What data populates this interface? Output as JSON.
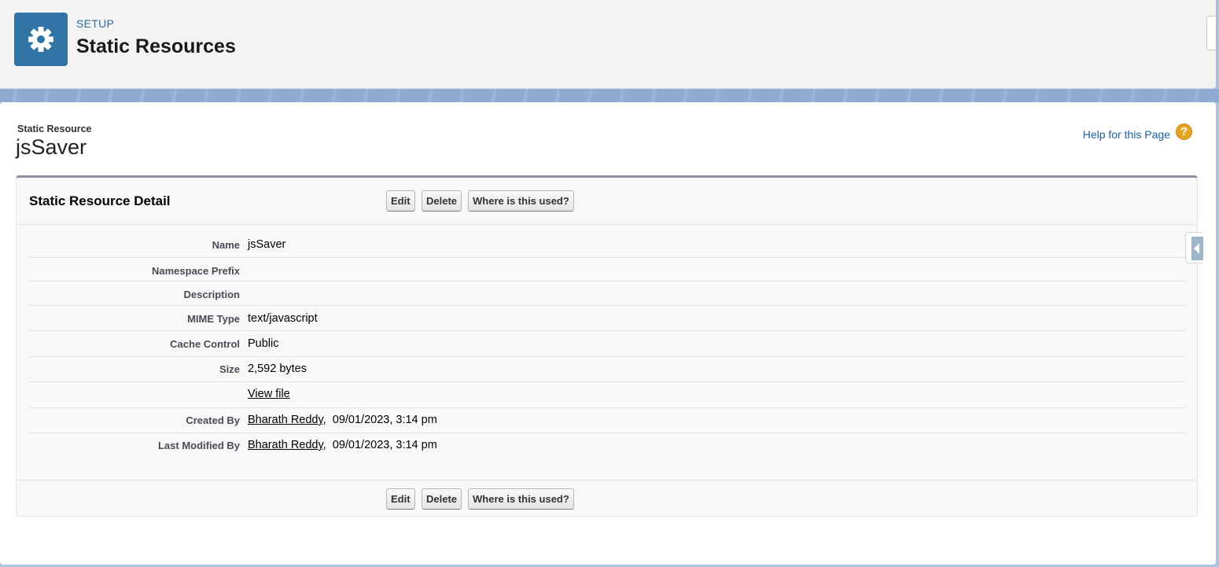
{
  "header": {
    "icon": "gear-icon",
    "section_label": "SETUP",
    "title": "Static Resources"
  },
  "page": {
    "type_label": "Static Resource",
    "name": "jsSaver",
    "help_link": "Help for this Page",
    "help_icon_glyph": "?"
  },
  "detail": {
    "title": "Static Resource Detail",
    "buttons": {
      "edit": "Edit",
      "delete": "Delete",
      "where_used": "Where is this used?"
    },
    "fields": {
      "name": {
        "label": "Name",
        "value": "jsSaver"
      },
      "namespace_prefix": {
        "label": "Namespace Prefix",
        "value": ""
      },
      "description": {
        "label": "Description",
        "value": ""
      },
      "mime_type": {
        "label": "MIME Type",
        "value": "text/javascript"
      },
      "cache_control": {
        "label": "Cache Control",
        "value": "Public"
      },
      "size": {
        "label": "Size",
        "value": "2,592 bytes"
      },
      "view_file": {
        "label": "",
        "value": "View file"
      },
      "created_by": {
        "label": "Created By",
        "user": "Bharath Reddy",
        "date": "09/01/2023, 3:14 pm"
      },
      "last_modified_by": {
        "label": "Last Modified By",
        "user": "Bharath Reddy",
        "date": "09/01/2023, 3:14 pm"
      }
    }
  },
  "colors": {
    "brand_blue": "#2f74a4",
    "link_blue": "#1a61a7",
    "help_orange": "#e8a320"
  }
}
